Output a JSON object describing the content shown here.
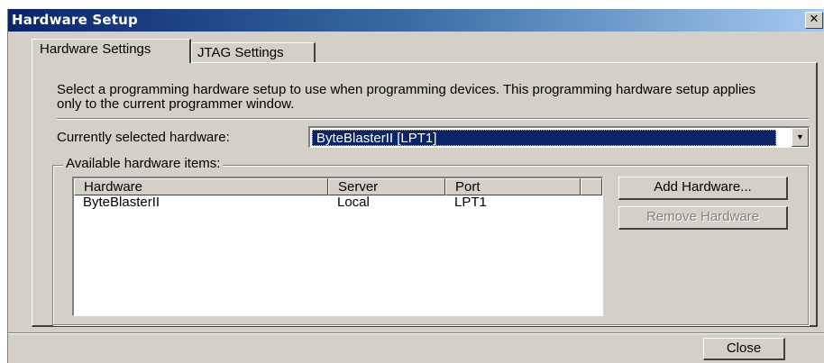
{
  "window": {
    "title": "Hardware Setup",
    "close_glyph": "✕"
  },
  "tabs": [
    {
      "label": "Hardware Settings",
      "active": true
    },
    {
      "label": "JTAG Settings",
      "active": false
    }
  ],
  "description": "Select a programming hardware setup to use when programming devices. This programming hardware setup applies only to the current programmer window.",
  "current_hardware": {
    "label": "Currently selected hardware:",
    "value": "ByteBlasterII [LPT1]"
  },
  "available": {
    "legend": "Available hardware items:",
    "columns": [
      "Hardware",
      "Server",
      "Port"
    ],
    "rows": [
      {
        "hardware": "ByteBlasterII",
        "server": "Local",
        "port": "LPT1"
      }
    ]
  },
  "buttons": {
    "add": "Add Hardware...",
    "remove": "Remove Hardware",
    "close": "Close"
  },
  "colors": {
    "title_start": "#0a246a",
    "title_end": "#a6caf0",
    "dialog_bg": "#d4d0c8",
    "selection": "#0a246a"
  }
}
